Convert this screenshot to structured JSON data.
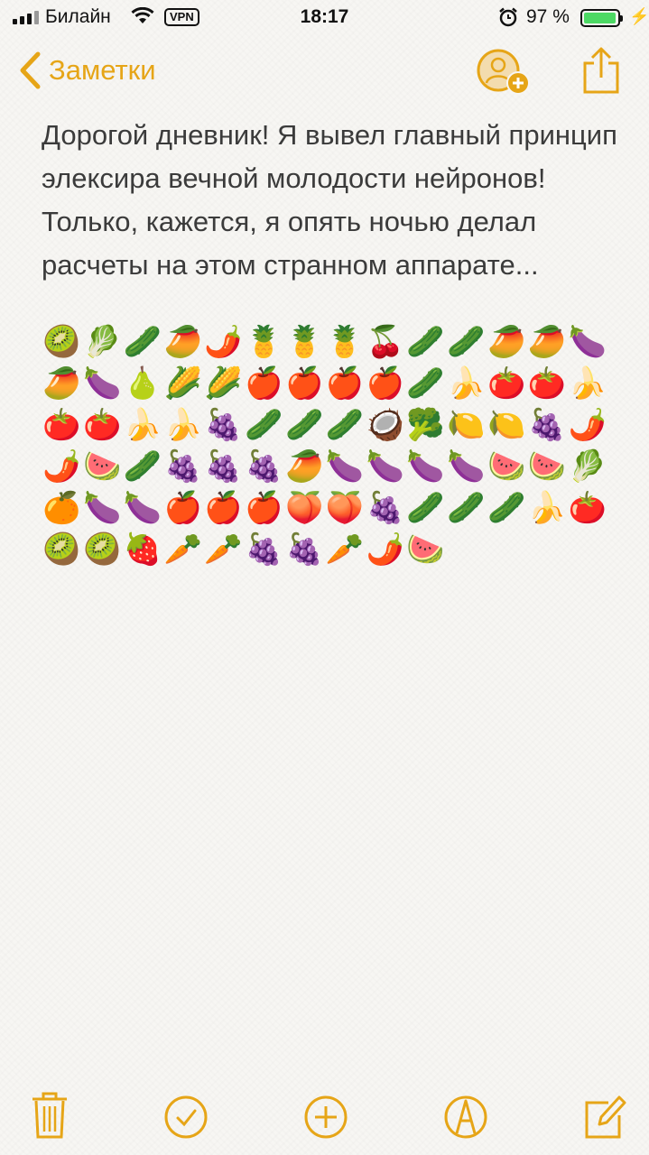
{
  "status_bar": {
    "carrier": "Билайн",
    "vpn": "VPN",
    "time": "18:17",
    "battery_percent": "97 %",
    "battery_level": 0.97
  },
  "nav": {
    "back_label": "Заметки"
  },
  "note": {
    "lines": [
      "Дорогой дневник! Я вывел главный принцип элексира вечной молодости нейронов!",
      "Только, кажется, я опять ночью делал расчеты на этом странном аппарате..."
    ],
    "emojis": [
      "🥝",
      "🥬",
      "🥒",
      "🥭",
      "🌶️",
      "🍍",
      "🍍",
      "🍍",
      "🍒",
      "🥒",
      "🥒",
      "🥭",
      "🥭",
      "🍆",
      "🥭",
      "🍆",
      "🍐",
      "🌽",
      "🌽",
      "🍎",
      "🍎",
      "🍎",
      "🍎",
      "🥒",
      "🍌",
      "🍅",
      "🍅",
      "🍌",
      "🍅",
      "🍅",
      "🍌",
      "🍌",
      "🍇",
      "🥒",
      "🥒",
      "🥒",
      "🥥",
      "🥦",
      "🍋",
      "🍋",
      "🍇",
      "🌶️",
      "🌶️",
      "🍉",
      "🥒",
      "🍇",
      "🍇",
      "🍇",
      "🥭",
      "🍆",
      "🍆",
      "🍆",
      "🍆",
      "🍉",
      "🍉",
      "🥬",
      "🍊",
      "🍆",
      "🍆",
      "🍎",
      "🍎",
      "🍎",
      "🍑",
      "🍑",
      "🍇",
      "🥒",
      "🥒",
      "🥒",
      "🍌",
      "🍅",
      "🥝",
      "🥝",
      "🍓",
      "🥕",
      "🥕",
      "🍇",
      "🍇",
      "🥕",
      "🌶️",
      "🍉"
    ]
  },
  "toolbar": {
    "icons": [
      "trash-icon",
      "checklist-icon",
      "add-icon",
      "markup-icon",
      "compose-icon"
    ]
  },
  "colors": {
    "accent": "#e6a517",
    "background": "#f7f6f3",
    "text": "#3b3b3b",
    "battery": "#4cd964"
  }
}
